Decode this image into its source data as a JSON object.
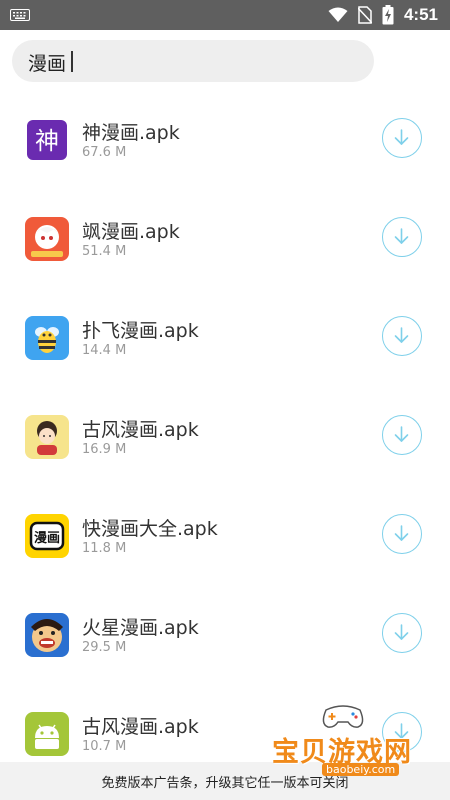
{
  "status_bar": {
    "time": "4:51"
  },
  "search": {
    "value": "漫画"
  },
  "apps": [
    {
      "name": "神漫画.apk",
      "size": "67.6 M",
      "icon": "shen-manhua-app-icon",
      "icon_color": "#6a2bb0"
    },
    {
      "name": "飒漫画.apk",
      "size": "51.4 M",
      "icon": "sa-manhua-app-icon",
      "icon_color": "#f05a3a"
    },
    {
      "name": "扑飞漫画.apk",
      "size": "14.4 M",
      "icon": "pufei-manhua-app-icon",
      "icon_color": "#3fa4f0"
    },
    {
      "name": "古风漫画.apk",
      "size": "16.9 M",
      "icon": "gufeng-manhua-app-icon",
      "icon_color": "#f6e48c"
    },
    {
      "name": "快漫画大全.apk",
      "size": "11.8 M",
      "icon": "kuai-manhua-app-icon",
      "icon_color": "#ffd400",
      "icon_text": "漫画"
    },
    {
      "name": "火星漫画.apk",
      "size": "29.5 M",
      "icon": "huoxing-manhua-app-icon",
      "icon_color": "#2a6fd0"
    },
    {
      "name": "古风漫画.apk",
      "size": "10.7 M",
      "icon": "android-app-icon",
      "icon_color": "#a4c639"
    }
  ],
  "ad_bar": {
    "text": "免费版本广告条，升级其它任一版本可关闭"
  },
  "watermark": {
    "text": "宝贝游戏网",
    "url": "baobeiy.com"
  },
  "colors": {
    "status_bar_bg": "#5f5f5f",
    "download_accent": "#7fd0ea",
    "watermark": "#f08a1a"
  }
}
